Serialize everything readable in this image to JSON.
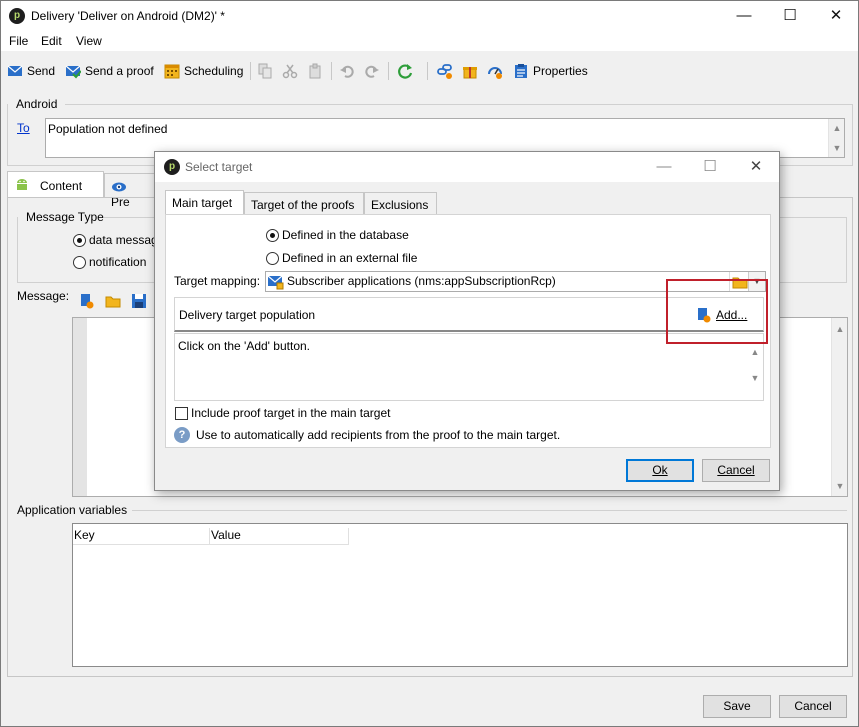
{
  "window": {
    "title": "Delivery 'Deliver on Android (DM2)' *",
    "controls": {
      "minimize": "—",
      "maximize": "☐",
      "close": "✕"
    }
  },
  "menu": {
    "items": [
      "File",
      "Edit",
      "View"
    ]
  },
  "toolbar": {
    "send": "Send",
    "send_proof": "Send a proof",
    "scheduling": "Scheduling",
    "properties": "Properties"
  },
  "android": {
    "section_label": "Android",
    "to_link": "To",
    "to_value": "Population not defined"
  },
  "tabs": {
    "content": "Content",
    "preview": "Pre"
  },
  "message_type": {
    "label": "Message Type",
    "option_data": "data messag",
    "option_notification": "notification"
  },
  "message": {
    "label": "Message:"
  },
  "app_variables": {
    "label": "Application variables",
    "columns": [
      "Key",
      "Value"
    ]
  },
  "footer": {
    "save": "Save",
    "cancel": "Cancel"
  },
  "dialog": {
    "title": "Select target",
    "tabs": [
      "Main target",
      "Target of the proofs",
      "Exclusions"
    ],
    "radio_database": "Defined in the database",
    "radio_external": "Defined in an external file",
    "mapping_label": "Target mapping:",
    "mapping_value": "Subscriber applications (nms:appSubscriptionRcp)",
    "population_label": "Delivery target population",
    "add_button": "Add...",
    "hint_text": "Click on the 'Add' button.",
    "include_proof": "Include proof target in the main target",
    "info_text": "Use to automatically add recipients from the proof to the main target.",
    "ok": "Ok",
    "cancel": "Cancel"
  },
  "colors": {
    "accent_blue": "#0078d7",
    "highlight_red": "#c0202b",
    "link_blue": "#0033cc"
  }
}
